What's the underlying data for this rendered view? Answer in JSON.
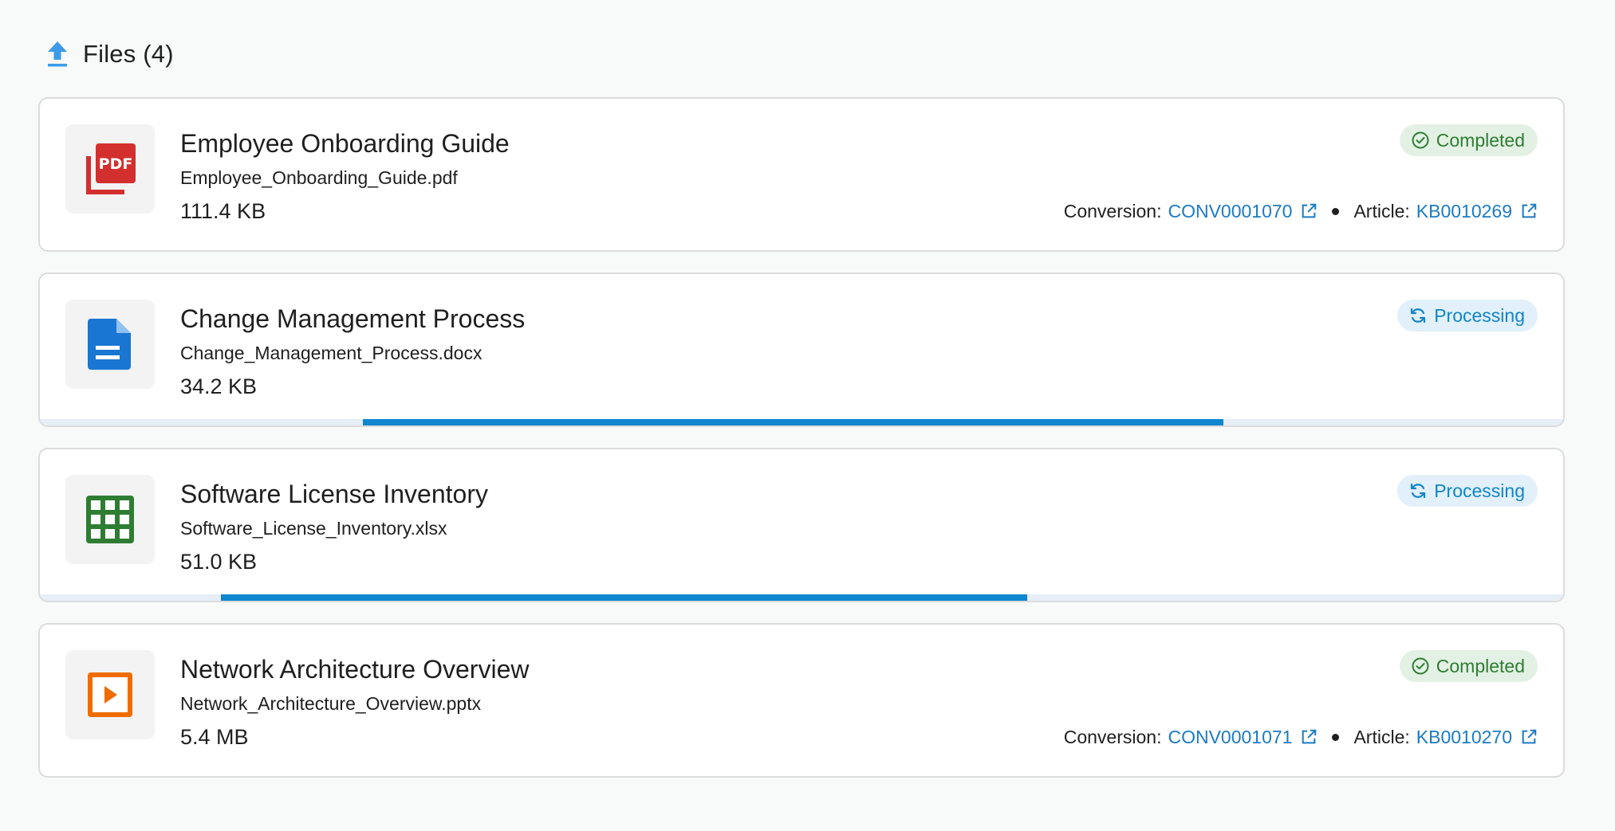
{
  "header": {
    "title": "Files (4)",
    "icon": "upload-icon"
  },
  "colors": {
    "completed": "#2e7d32",
    "processing": "#1185c8",
    "link": "#1b7bc4",
    "progress": "#0f86cf"
  },
  "files": [
    {
      "title": "Employee Onboarding Guide",
      "filename": "Employee_Onboarding_Guide.pdf",
      "size": "111.4 KB",
      "type_icon": "pdf-icon",
      "status": "Completed",
      "conversion_label": "Conversion:",
      "conversion_id": "CONV0001070",
      "article_label": "Article:",
      "article_id": "KB0010269"
    },
    {
      "title": "Change Management Process",
      "filename": "Change_Management_Process.docx",
      "size": "34.2 KB",
      "type_icon": "document-icon",
      "status": "Processing",
      "progress": {
        "start": 0.212,
        "end": 0.777
      }
    },
    {
      "title": "Software License Inventory",
      "filename": "Software_License_Inventory.xlsx",
      "size": "51.0 KB",
      "type_icon": "spreadsheet-icon",
      "status": "Processing",
      "progress": {
        "start": 0.119,
        "end": 0.648
      }
    },
    {
      "title": "Network Architecture Overview",
      "filename": "Network_Architecture_Overview.pptx",
      "size": "5.4 MB",
      "type_icon": "presentation-icon",
      "status": "Completed",
      "conversion_label": "Conversion:",
      "conversion_id": "CONV0001071",
      "article_label": "Article:",
      "article_id": "KB0010270"
    }
  ]
}
